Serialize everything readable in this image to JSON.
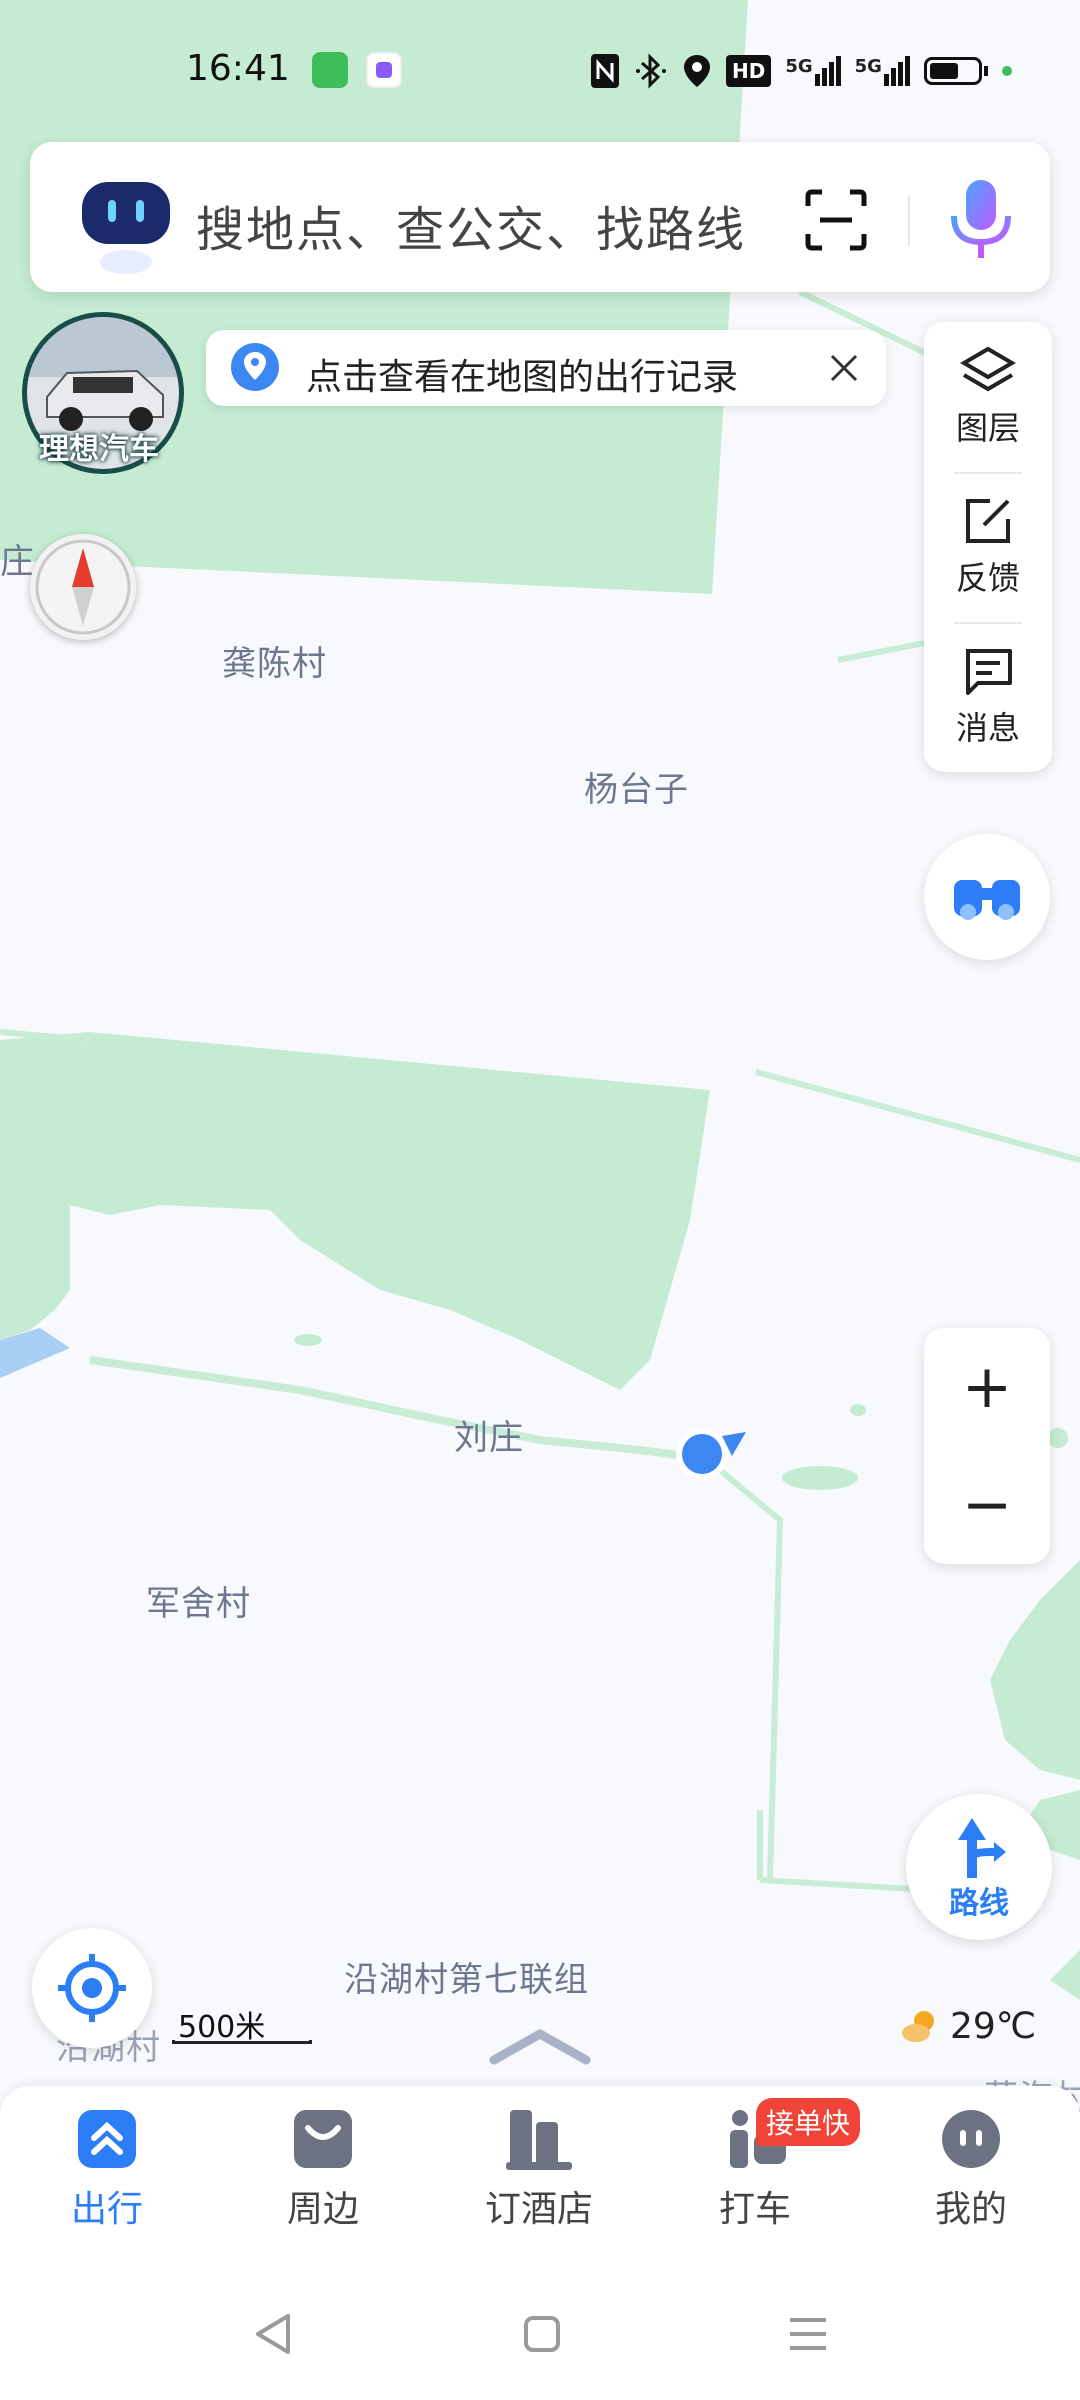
{
  "status_bar": {
    "time": "16:41",
    "icons": [
      "message-icon",
      "app-icon",
      "nfc-icon",
      "bluetooth-icon",
      "location-icon",
      "hd-icon",
      "signal-5g-icon",
      "signal-5g-icon",
      "battery-icon"
    ],
    "signal_1": "5G",
    "signal_2": "5G",
    "hd": "HD"
  },
  "search": {
    "placeholder": "搜地点、查公交、找路线"
  },
  "tip_banner": {
    "text": "点击查看在地图的出行记录"
  },
  "car_avatar": {
    "label": "理想汽车"
  },
  "tools": {
    "items": [
      {
        "label": "图层",
        "icon": "layers-icon"
      },
      {
        "label": "反馈",
        "icon": "feedback-icon"
      },
      {
        "label": "消息",
        "icon": "message-icon"
      }
    ]
  },
  "map": {
    "places": {
      "p1": "庄",
      "p2": "龚陈村",
      "p3": "杨台子",
      "p4": "刘庄",
      "p5": "军舍村",
      "p6": "沿湖村第七联组",
      "p7": "沿湖村",
      "p8": "蒋海村"
    }
  },
  "zoom": {
    "plus": "+",
    "minus": "−"
  },
  "route": {
    "label": "路线"
  },
  "scale": {
    "label": "500米"
  },
  "weather": {
    "temp": "29℃"
  },
  "tabs": {
    "items": [
      {
        "label": "出行",
        "active": true
      },
      {
        "label": "周边",
        "active": false
      },
      {
        "label": "订酒店",
        "active": false
      },
      {
        "label": "打车",
        "active": false
      },
      {
        "label": "我的",
        "active": false
      }
    ],
    "badge": "接单快"
  },
  "colors": {
    "accent": "#2b7ef5",
    "green_area": "#c5ecd3",
    "map_bg": "#f7f9fc",
    "badge": "#f04438"
  }
}
